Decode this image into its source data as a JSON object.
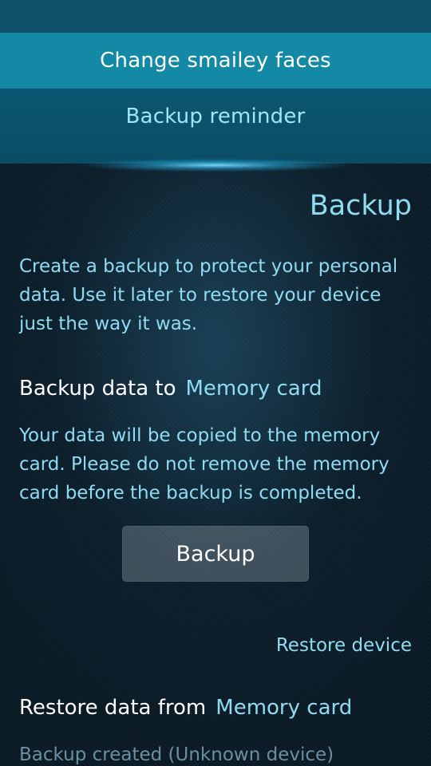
{
  "pulley_menu": {
    "items": [
      {
        "label": "Change smailey faces"
      },
      {
        "label": "Backup reminder"
      }
    ]
  },
  "page": {
    "title": "Backup",
    "intro": "Create a backup to protect your personal data. Use it later to restore your device just the way it was."
  },
  "backup_section": {
    "combo_label": "Backup data to",
    "combo_value": "Memory card",
    "description": "Your data will be copied to the memory card. Please do not remove the memory card before the backup is completed.",
    "button_label": "Backup"
  },
  "restore_section": {
    "header": "Restore device",
    "combo_label": "Restore data from",
    "combo_value": "Memory card",
    "backup_info": "Backup created (Unknown device)"
  },
  "colors": {
    "highlight": "#1389a6",
    "accent_text": "#8fdcf2",
    "background": "#0b1b26"
  }
}
